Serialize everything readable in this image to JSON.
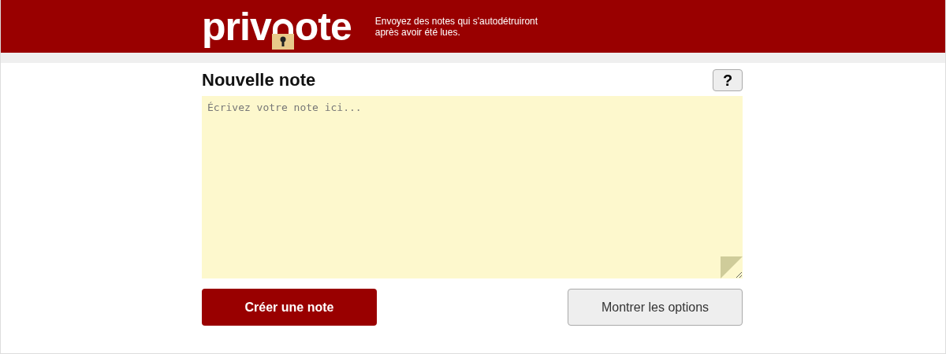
{
  "header": {
    "logo_start": "priv",
    "logo_end": "ote",
    "tagline": "Envoyez des notes qui s'autodétruiront après avoir été lues."
  },
  "note": {
    "title": "Nouvelle note",
    "help_button": "?",
    "placeholder": "Écrivez votre note ici..."
  },
  "buttons": [
    {
      "label": "Créer une note",
      "kind": "primary"
    },
    {
      "label": "Montrer les options",
      "kind": "secondary"
    }
  ]
}
